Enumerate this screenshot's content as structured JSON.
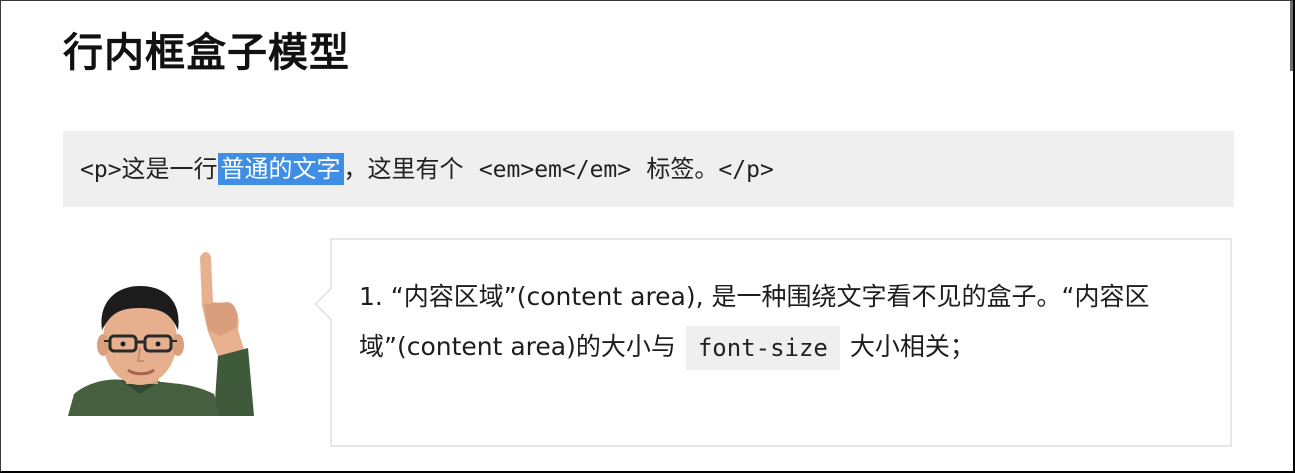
{
  "slide": {
    "title": "行内框盒子模型"
  },
  "code_example": {
    "part_p_open": "<p>",
    "part_before_selection": "这是一行",
    "part_selected": "普通的文字",
    "part_after_selection": "，这里有个",
    "part_em_tag": "<em>em</em>",
    "part_after_em": "标签。",
    "part_p_close": "</p>"
  },
  "callout": {
    "text_1": "1. “内容区域”(content area), 是一种围绕文字看不见的盒子。“内容区域”(content area)的大小与",
    "code": "font-size",
    "text_2": "大小相关；"
  },
  "colors": {
    "selection": "#3e8ee6",
    "code_background": "#efefef",
    "callout_border": "#e7e7e7"
  }
}
